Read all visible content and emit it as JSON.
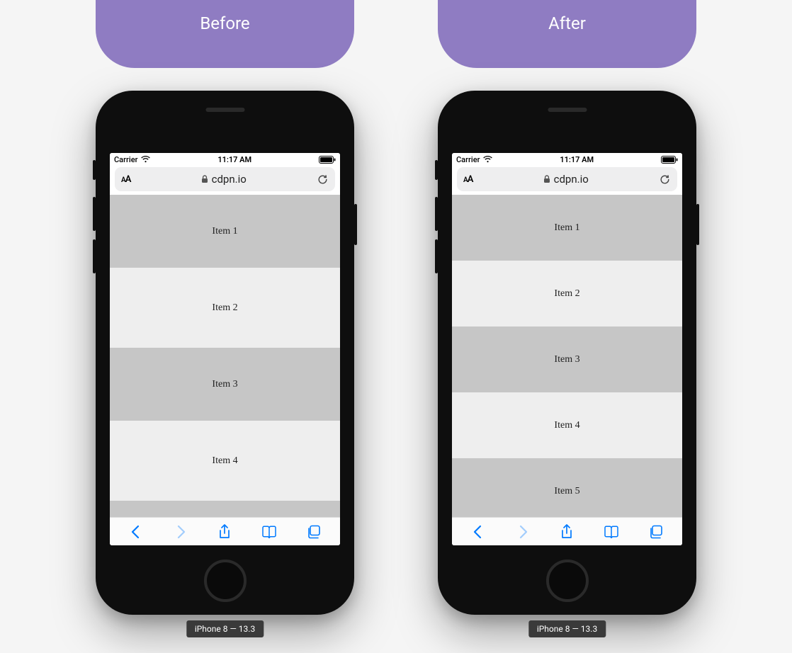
{
  "headers": {
    "before": "Before",
    "after": "After"
  },
  "status": {
    "carrier": "Carrier",
    "time": "11:17 AM"
  },
  "url": {
    "aa": "AA",
    "domain": "cdpn.io"
  },
  "before_items": [
    "Item 1",
    "Item 2",
    "Item 3",
    "Item 4"
  ],
  "after_items": [
    "Item 1",
    "Item 2",
    "Item 3",
    "Item 4",
    "Item 5"
  ],
  "device_label": "iPhone 8 — 13.3",
  "colors": {
    "accent": "#8f7cc2",
    "ios_blue": "#007aff"
  }
}
